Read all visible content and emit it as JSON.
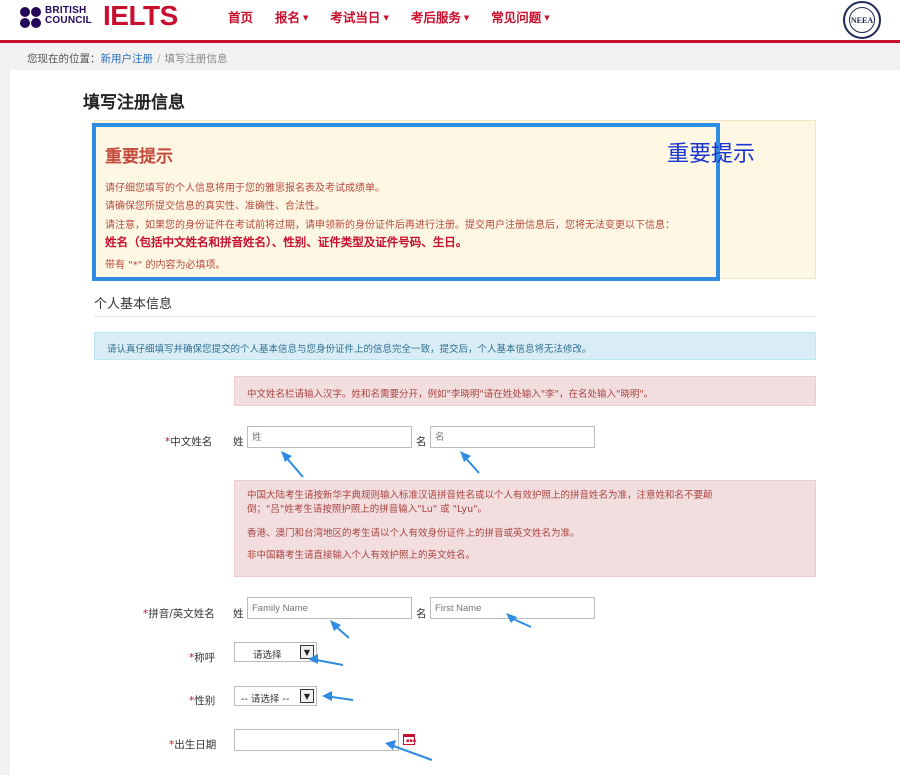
{
  "header": {
    "bc_logo_text_1": "BRITISH",
    "bc_logo_text_2": "COUNCIL",
    "ielts_logo": "IELTS",
    "nav": [
      {
        "label": "首页",
        "has_menu": false
      },
      {
        "label": "报名",
        "has_menu": true
      },
      {
        "label": "考试当日",
        "has_menu": true
      },
      {
        "label": "考后服务",
        "has_menu": true
      },
      {
        "label": "常见问题",
        "has_menu": true
      }
    ],
    "seal_text": "NEEA"
  },
  "breadcrumb": {
    "prefix": "您现在的位置：",
    "link": "新用户注册",
    "separator": "/",
    "current": "填写注册信息"
  },
  "page": {
    "title": "填写注册信息"
  },
  "notice": {
    "title": "重要提示",
    "lines": [
      "请仔细您填写的个人信息将用于您的雅思报名表及考试成绩单。",
      "请确保您所提交信息的真实性、准确性、合法性。",
      "请注意，如果您的身份证件在考试前将过期，请申领新的身份证件后再进行注册。提交用户注册信息后，您将无法变更以下信息："
    ],
    "bold_line": "姓名（包括中文姓名和拼音姓名）、性别、证件类型及证件号码、生日。",
    "last_line": "带有 \"*\" 的内容为必填项。",
    "annotation": "重要提示"
  },
  "section": {
    "title": "个人基本信息",
    "info": "请认真仔细填写并确保您提交的个人基本信息与您身份证件上的信息完全一致，提交后，个人基本信息将无法修改。"
  },
  "alerts": {
    "chinese_name": "中文姓名栏请输入汉字。姓和名需要分开，例如\"李晓明\"请在姓处输入\"李\"，在名处输入\"晓明\"。",
    "pinyin": [
      "中国大陆考生请按新华字典规则输入标准汉语拼音姓名或以个人有效护照上的拼音姓名为准，注意姓和名不要颠",
      "倒；\"吕\"姓考生请按照护照上的拼音输入\"Lu\" 或 \"Lyu\"。",
      "香港、澳门和台湾地区的考生请以个人有效身份证件上的拼音或英文姓名为准。",
      "非中国籍考生请直接输入个人有效护照上的英文姓名。"
    ]
  },
  "form": {
    "required_mark": "*",
    "surname_label": "姓",
    "given_label": "名",
    "chinese_name": {
      "label": "中文姓名",
      "surname_placeholder": "姓",
      "given_placeholder": "名"
    },
    "pinyin_name": {
      "label": "拼音/英文姓名",
      "surname_placeholder": "Family Name",
      "given_placeholder": "First Name"
    },
    "title_field": {
      "label": "称呼",
      "selected": "请选择"
    },
    "gender_field": {
      "label": "性别",
      "selected": "-- 请选择 --"
    },
    "dob_field": {
      "label": "出生日期",
      "value": ""
    }
  },
  "colors": {
    "brand_red": "#c8102e",
    "highlight_blue": "#2f8ce3",
    "annotation_blue": "#1a35d1"
  }
}
